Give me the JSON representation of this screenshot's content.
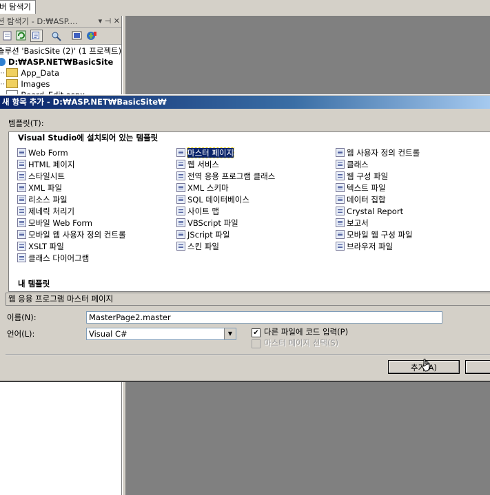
{
  "tabstrip": {
    "active_tab": "버 탐색기"
  },
  "solution_explorer": {
    "title": "션 탐색기 - D:₩ASP....",
    "title_controls": "▾ ⊣ ✕",
    "tree": [
      "솔루션 'BasicSite (2)' (1 프로젝트)",
      "D:₩ASP.NET₩BasicSite",
      "App_Data",
      "Images",
      "Board_Edit.aspx"
    ]
  },
  "dialog": {
    "title": "새 항목 추가 - D:₩ASP.NET₩BasicSite₩",
    "templates_label": "템플릿(T):",
    "section_installed": "Visual Studio에 설치되어 있는 템플릿",
    "section_my": "내 템플릿",
    "templates_col1": [
      "Web Form",
      "HTML 페이지",
      "스타일시트",
      "XML 파일",
      "리소스 파일",
      "제네릭 처리기",
      "모바일 Web Form",
      "모바일 웹 사용자 정의 컨트롤",
      "XSLT 파일",
      "클래스 다이어그램"
    ],
    "templates_col2": [
      "마스터 페이지",
      "웹 서비스",
      "전역 응용 프로그램 클래스",
      "XML 스키마",
      "SQL 데이터베이스",
      "사이트 맵",
      "VBScript 파일",
      "JScript 파일",
      "스킨 파일"
    ],
    "templates_col3": [
      "웹 사용자 정의 컨트롤",
      "클래스",
      "웹 구성 파일",
      "텍스트 파일",
      "데이터 집합",
      "Crystal Report",
      "보고서",
      "모바일 웹 구성 파일",
      "브라우저 파일"
    ],
    "description": "웹 응용 프로그램 마스터 페이지",
    "name_label": "이름(N):",
    "name_value": "MasterPage2.master",
    "language_label": "언어(L):",
    "language_value": "Visual C#",
    "checkbox_code": "다른 파일에 코드 입력(P)",
    "checkbox_master": "마스터 페이지 선택(S)",
    "add_button": "추가(A)",
    "cancel_button": ""
  }
}
